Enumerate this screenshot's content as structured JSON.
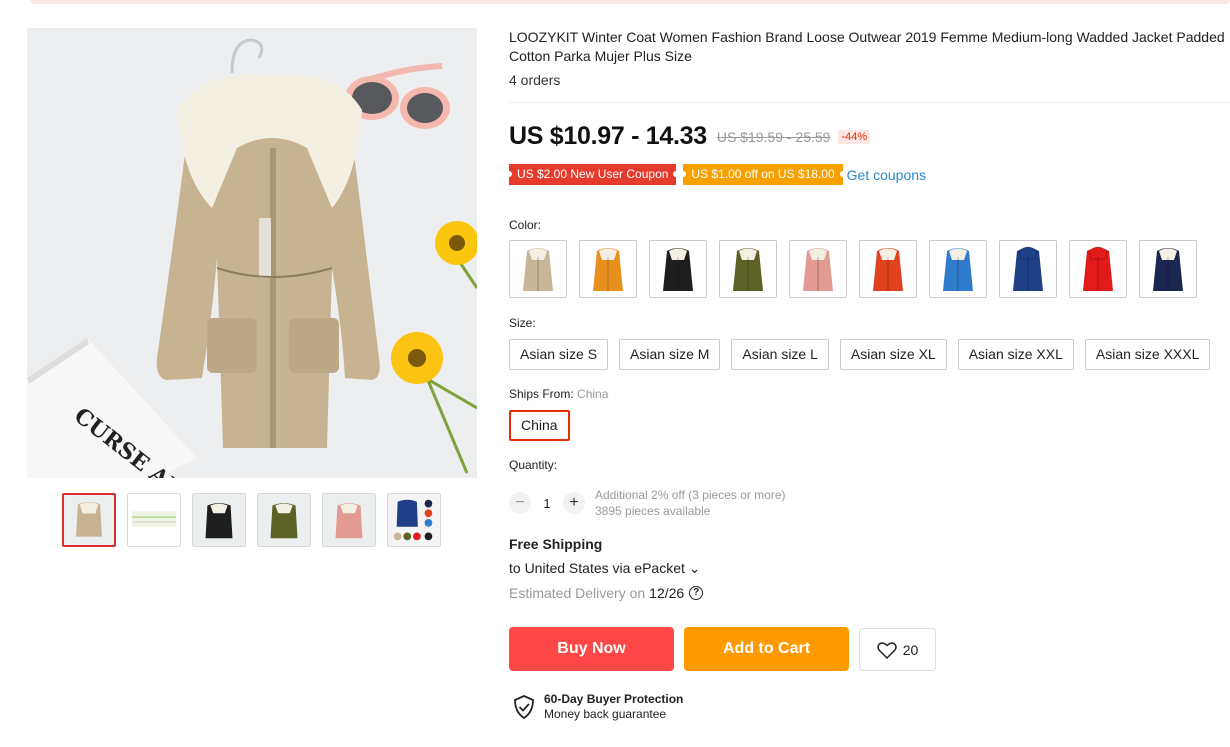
{
  "product": {
    "title": "LOOZYKIT Winter Coat Women Fashion Brand Loose Outwear 2019 Femme Medium-long Wadded Jacket Padded Cotton Parka Mujer Plus Size",
    "orders": "4 orders",
    "image_text": "CURSE ALLTTLE AND ARE"
  },
  "price": {
    "current": "US $10.97 - 14.33",
    "original": "US $19.59 - 25.59",
    "discount": "-44%"
  },
  "coupons": {
    "new_user": "US $2.00 New User Coupon",
    "store": "US $1.00 off on US $18.00",
    "get_label": "Get coupons"
  },
  "color": {
    "label": "Color:",
    "swatches": [
      {
        "name": "khaki",
        "hex": "#c9b597"
      },
      {
        "name": "orange",
        "hex": "#e8901e"
      },
      {
        "name": "black",
        "hex": "#1e1e1e"
      },
      {
        "name": "army-green",
        "hex": "#5c6125"
      },
      {
        "name": "pink",
        "hex": "#e29a93"
      },
      {
        "name": "red-orange",
        "hex": "#e0411e"
      },
      {
        "name": "blue",
        "hex": "#2f7ccc"
      },
      {
        "name": "navy-hooded",
        "hex": "#1f3f87"
      },
      {
        "name": "red-hooded",
        "hex": "#e21a1a"
      },
      {
        "name": "dark-navy",
        "hex": "#1a2550"
      }
    ]
  },
  "size": {
    "label": "Size:",
    "options": [
      "Asian size S",
      "Asian size M",
      "Asian size L",
      "Asian size XL",
      "Asian size XXL",
      "Asian size XXXL"
    ]
  },
  "ships_from": {
    "label": "Ships From:",
    "value": "China",
    "option": "China"
  },
  "quantity": {
    "label": "Quantity:",
    "minus": "−",
    "value": "1",
    "plus": "+",
    "note1": "Additional 2% off (3 pieces or more)",
    "note2": "3895 pieces available"
  },
  "shipping": {
    "title": "Free Shipping",
    "via": "to United States via ePacket",
    "chevron": "⌄",
    "delivery_label": "Estimated Delivery on",
    "delivery_date": "12/26",
    "help": "?"
  },
  "actions": {
    "buy_now": "Buy Now",
    "add_to_cart": "Add to Cart",
    "wishlist_count": "20"
  },
  "protection": {
    "title": "60-Day Buyer Protection",
    "subtitle": "Money back guarantee"
  },
  "colors": {
    "accent_red": "#ff4747",
    "accent_orange": "#ff9a00",
    "link_blue": "#2a88c7"
  }
}
